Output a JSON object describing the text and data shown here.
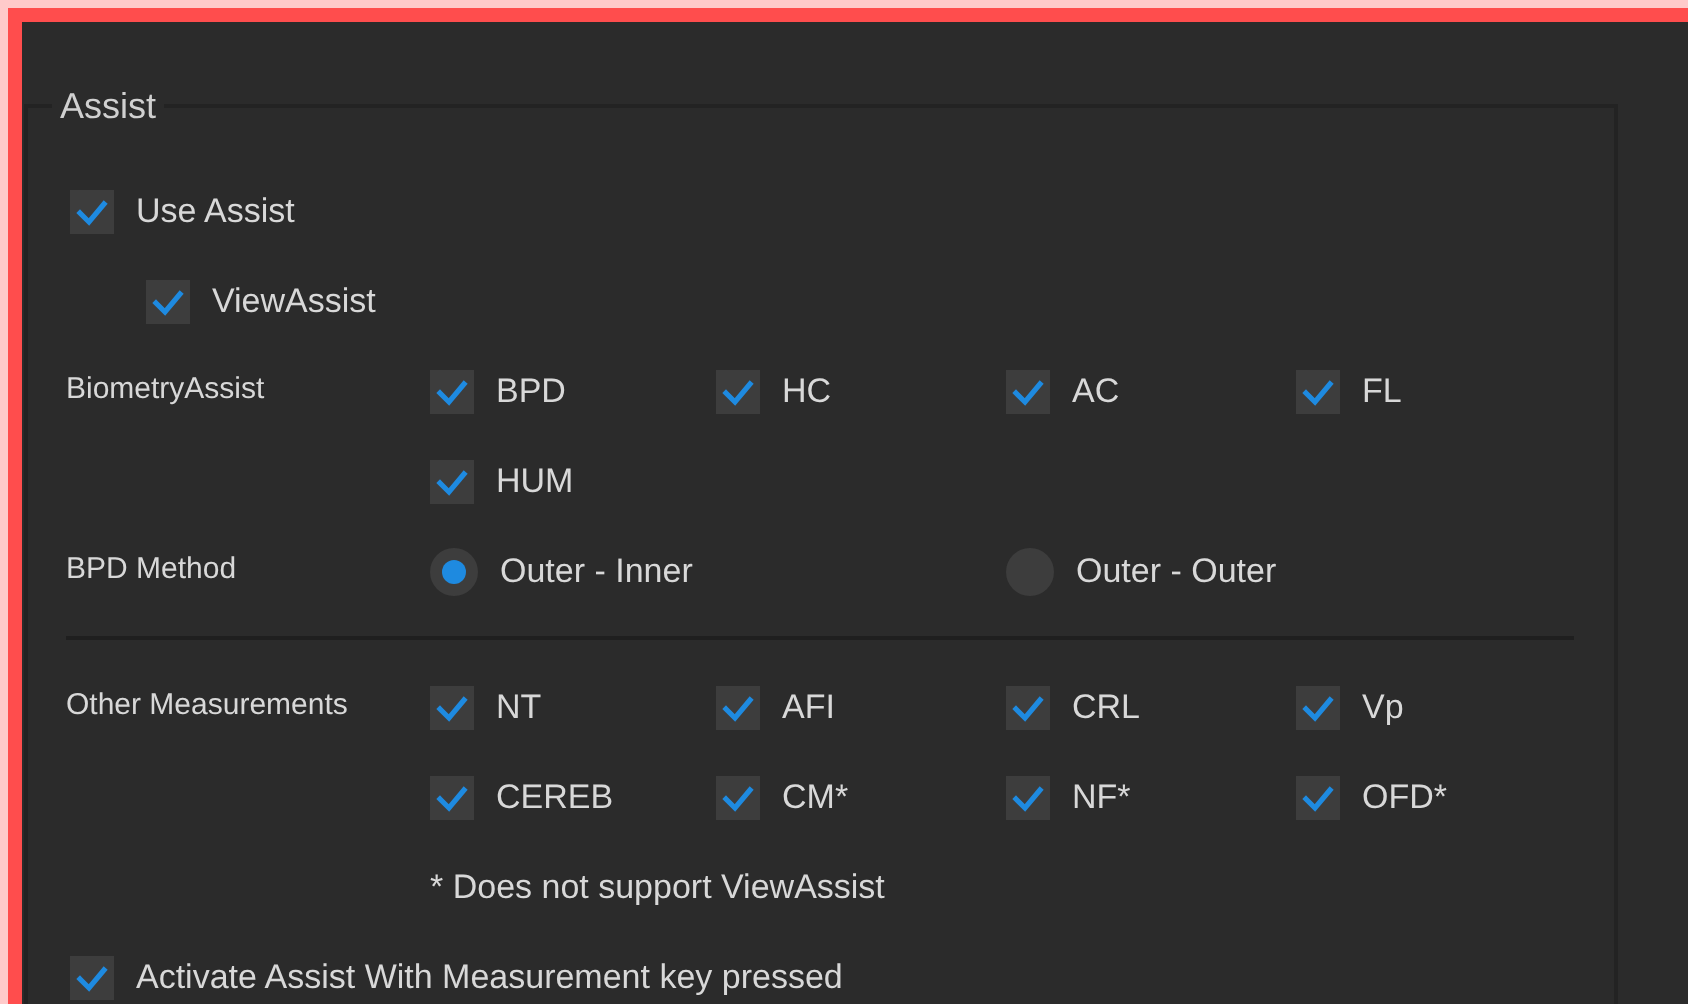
{
  "group": {
    "title": "Assist"
  },
  "use_assist": {
    "label": "Use Assist",
    "checked": true
  },
  "view_assist": {
    "label": "ViewAssist",
    "checked": true
  },
  "biometry": {
    "label": "BiometryAssist",
    "items": [
      {
        "label": "BPD",
        "checked": true
      },
      {
        "label": "HC",
        "checked": true
      },
      {
        "label": "AC",
        "checked": true
      },
      {
        "label": "FL",
        "checked": true
      },
      {
        "label": "HUM",
        "checked": true
      }
    ]
  },
  "bpd_method": {
    "label": "BPD Method",
    "options": [
      {
        "label": "Outer - Inner",
        "selected": true
      },
      {
        "label": "Outer - Outer",
        "selected": false
      }
    ]
  },
  "other": {
    "label": "Other Measurements",
    "items": [
      {
        "label": "NT",
        "checked": true
      },
      {
        "label": "AFI",
        "checked": true
      },
      {
        "label": "CRL",
        "checked": true
      },
      {
        "label": "Vp",
        "checked": true
      },
      {
        "label": "CEREB",
        "checked": true
      },
      {
        "label": "CM*",
        "checked": true
      },
      {
        "label": "NF*",
        "checked": true
      },
      {
        "label": "OFD*",
        "checked": true
      }
    ]
  },
  "note": "* Does not support ViewAssist",
  "activate": {
    "label": "Activate Assist With Measurement key pressed",
    "checked": true
  }
}
